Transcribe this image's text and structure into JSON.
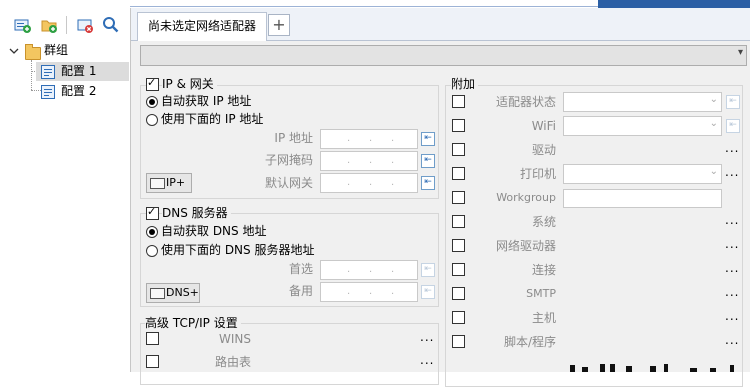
{
  "toolbar": {
    "icons": [
      "add-network-icon",
      "add-folder-icon",
      "delete-icon",
      "search-icon"
    ]
  },
  "tree": {
    "root_label": "群组",
    "items": [
      {
        "label": "配置 1",
        "selected": true
      },
      {
        "label": "配置 2",
        "selected": false
      }
    ]
  },
  "tabs": {
    "active_label": "尚未选定网络适配器",
    "add_symbol": "+"
  },
  "adapter_select": {
    "value": ""
  },
  "ip_group": {
    "checkbox_label": "IP & 网关",
    "checked": true,
    "auto_label": "自动获取 IP 地址",
    "manual_label": "使用下面的 IP 地址",
    "fields": [
      {
        "label": "IP 地址",
        "value": ". . ."
      },
      {
        "label": "子网掩码",
        "value": ". . ."
      },
      {
        "label": "默认网关",
        "value": ". . ."
      }
    ],
    "ip_plus_label": "IP+"
  },
  "dns_group": {
    "checkbox_label": "DNS 服务器",
    "checked": true,
    "auto_label": "自动获取 DNS 地址",
    "manual_label": "使用下面的 DNS 服务器地址",
    "fields": [
      {
        "label": "首选",
        "value": ". . ."
      },
      {
        "label": "备用",
        "value": ". . ."
      }
    ],
    "dns_plus_label": "DNS+"
  },
  "advanced": {
    "title": "高级 TCP/IP 设置",
    "rows": [
      {
        "label": "WINS",
        "more": "..."
      },
      {
        "label": "路由表",
        "more": "..."
      }
    ]
  },
  "extra": {
    "title": "附加",
    "rows": [
      {
        "label": "适配器状态",
        "control": "dropdown"
      },
      {
        "label": "WiFi",
        "control": "dropdown"
      },
      {
        "label": "驱动",
        "control": "more",
        "more": "..."
      },
      {
        "label": "打印机",
        "control": "dropdown-more",
        "more": "..."
      },
      {
        "label": "Workgroup",
        "control": "text"
      },
      {
        "label": "系统",
        "control": "more",
        "more": "..."
      },
      {
        "label": "网络驱动器",
        "control": "more",
        "more": "..."
      },
      {
        "label": "连接",
        "control": "more",
        "more": "..."
      },
      {
        "label": "SMTP",
        "control": "more",
        "more": "..."
      },
      {
        "label": "主机",
        "control": "more",
        "more": "..."
      },
      {
        "label": "脚本/程序",
        "control": "more",
        "more": "..."
      }
    ]
  },
  "colors": {
    "accent": "#2b5fa5",
    "selection": "#dcdcdc",
    "panel": "#f0f0f0"
  }
}
